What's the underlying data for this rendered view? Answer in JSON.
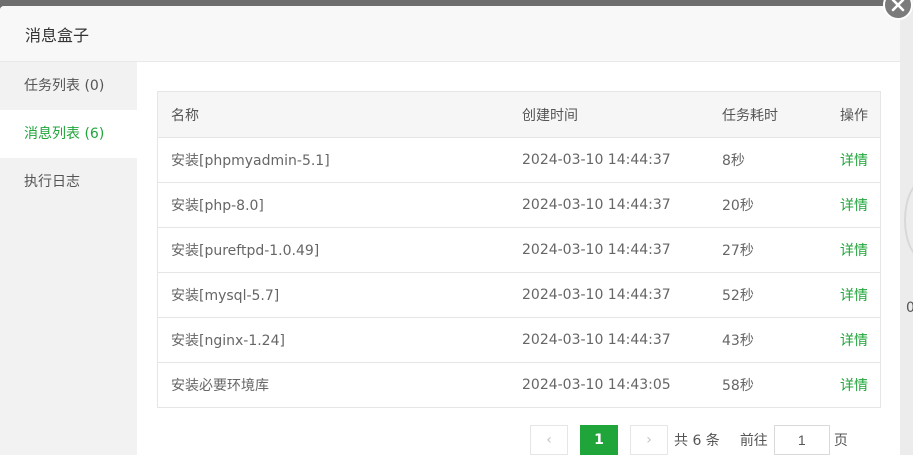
{
  "dialog": {
    "title": "消息盒子"
  },
  "sidebar": {
    "items": [
      {
        "label": "任务列表 (0)"
      },
      {
        "label": "消息列表 (6)"
      },
      {
        "label": "执行日志"
      }
    ]
  },
  "table": {
    "headers": [
      "名称",
      "创建时间",
      "任务耗时",
      "操作"
    ],
    "rows": [
      {
        "name": "安装[phpmyadmin-5.1]",
        "created": "2024-03-10 14:44:37",
        "duration": "8秒",
        "action": "详情"
      },
      {
        "name": "安装[php-8.0]",
        "created": "2024-03-10 14:44:37",
        "duration": "20秒",
        "action": "详情"
      },
      {
        "name": "安装[pureftpd-1.0.49]",
        "created": "2024-03-10 14:44:37",
        "duration": "27秒",
        "action": "详情"
      },
      {
        "name": "安装[mysql-5.7]",
        "created": "2024-03-10 14:44:37",
        "duration": "52秒",
        "action": "详情"
      },
      {
        "name": "安装[nginx-1.24]",
        "created": "2024-03-10 14:44:37",
        "duration": "43秒",
        "action": "详情"
      },
      {
        "name": "安装必要环境库",
        "created": "2024-03-10 14:43:05",
        "duration": "58秒",
        "action": "详情"
      }
    ]
  },
  "pager": {
    "prev": "‹",
    "current": "1",
    "next": "›",
    "total": "共 6 条",
    "goto": "前往",
    "input_value": "1",
    "unit": "页"
  },
  "background": {
    "char": "0"
  },
  "colors": {
    "accent": "#20a53a",
    "sidebar_bg": "#f2f2f2",
    "header_bg": "#f8f8f8"
  },
  "icons": {
    "close": "close-icon",
    "prev": "chevron-left-icon",
    "next": "chevron-right-icon"
  }
}
